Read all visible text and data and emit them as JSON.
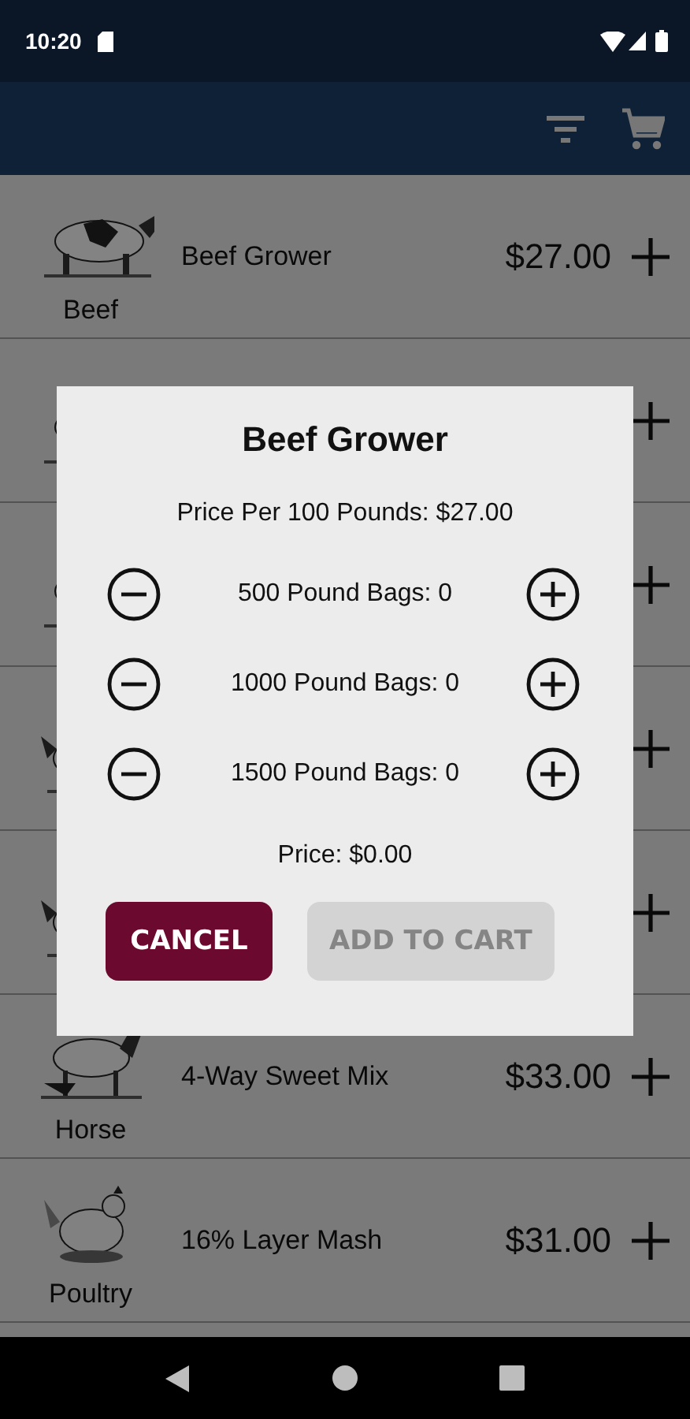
{
  "status_bar": {
    "time": "10:20"
  },
  "products": [
    {
      "kind": "full",
      "category": "Beef",
      "name": "Beef Grower",
      "price": "$27.00"
    },
    {
      "kind": "covered"
    },
    {
      "kind": "covered"
    },
    {
      "kind": "covered"
    },
    {
      "kind": "covered"
    },
    {
      "kind": "full",
      "category": "Horse",
      "name": "4-Way Sweet Mix",
      "price": "$33.00"
    },
    {
      "kind": "full",
      "category": "Poultry",
      "name": "16% Layer Mash",
      "price": "$31.00"
    }
  ],
  "dialog": {
    "title": "Beef Grower",
    "price_per": "Price Per 100 Pounds: $27.00",
    "quantities": [
      {
        "label": "500 Pound Bags: 0"
      },
      {
        "label": "1000 Pound Bags: 0"
      },
      {
        "label": "1500 Pound Bags: 0"
      }
    ],
    "total": "Price: $0.00",
    "buttons": [
      {
        "kind": "cancel",
        "label": "CANCEL",
        "disabled": false
      },
      {
        "kind": "confirm",
        "label": "ADD TO CART",
        "disabled": true
      }
    ]
  }
}
